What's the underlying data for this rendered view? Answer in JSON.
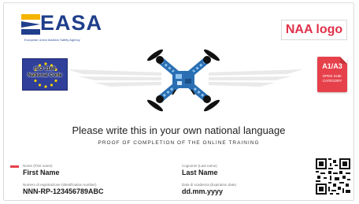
{
  "logo": {
    "name": "EASA",
    "tagline": "European Union Aviation Safety Agency"
  },
  "naa_logo": "NAA logo",
  "flag": {
    "text_line1": "ISO 3166",
    "text_line2": "National Code"
  },
  "category": {
    "title": "A1/A3",
    "subtitle": "OPEN SUB-CATEGORY"
  },
  "headline": "Please write this in your own national language",
  "subline": "PROOF OF COMPLETION OF THE ONLINE TRAINING",
  "fields": {
    "first_name": {
      "label": "Nome (First name)",
      "value": "First Name"
    },
    "last_name": {
      "label": "Cognome (Last name)",
      "value": "Last Name"
    },
    "registration": {
      "label": "Numero di registrazione (identification number)",
      "value": "NNN-RP-123456789ABC"
    },
    "expiry": {
      "label": "Data di scadenza (Expiration date)",
      "value": "dd.mm.yyyy"
    }
  },
  "colors": {
    "easa_blue": "#1f3e8c",
    "accent_red": "#e6414b",
    "drone_blue": "#2a6fb3"
  }
}
